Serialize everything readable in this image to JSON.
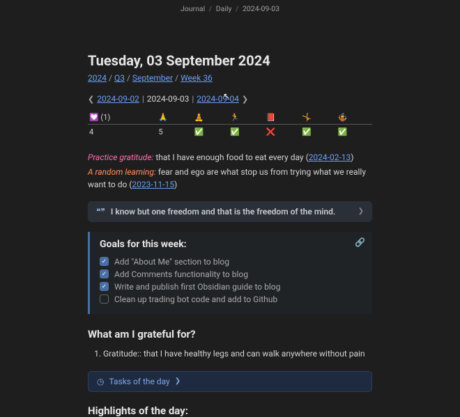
{
  "breadcrumb": {
    "a": "Journal",
    "b": "Daily",
    "c": "2024-09-03"
  },
  "title": "Tuesday, 03 September 2024",
  "nav": {
    "year": "2024",
    "quarter": "Q3",
    "month": "September",
    "week": "Week 36"
  },
  "daynav": {
    "prev": "2024-09-02",
    "current": "2024-09-03",
    "next": "2024-09-04"
  },
  "habits": {
    "headers": [
      "💟 (1)",
      "🙏",
      "🧘",
      "🏃",
      "📕",
      "🤸",
      "🤹"
    ],
    "values": [
      "4",
      "5",
      "✅",
      "✅",
      "❌",
      "✅",
      "✅"
    ]
  },
  "gratitude_practice": {
    "lead": "Practice gratitude:",
    "text": " that I have enough food to eat every day (",
    "link": "2024-02-13",
    "after": ")"
  },
  "random_learning": {
    "lead": "A random learning:",
    "text": " fear and ego are what stop us from trying what we really want to do (",
    "link": "2023-11-15",
    "after": ")"
  },
  "quote": "I know but one freedom and that is the freedom of the mind.",
  "goals": {
    "heading": "Goals for this week:",
    "items": [
      {
        "done": true,
        "text": "Add \"About Me\" section to blog"
      },
      {
        "done": true,
        "text": "Add Comments functionality to blog"
      },
      {
        "done": true,
        "text": "Write and publish first Obsidian guide to blog"
      },
      {
        "done": false,
        "text": "Clean up trading bot code and add to Github"
      }
    ]
  },
  "section_grateful": "What am I grateful for?",
  "grateful_items": [
    "Gratitude:: that I have healthy legs and can walk anywhere without pain"
  ],
  "tasks_callout": "Tasks of the day",
  "section_highlights": "Highlights of the day:"
}
